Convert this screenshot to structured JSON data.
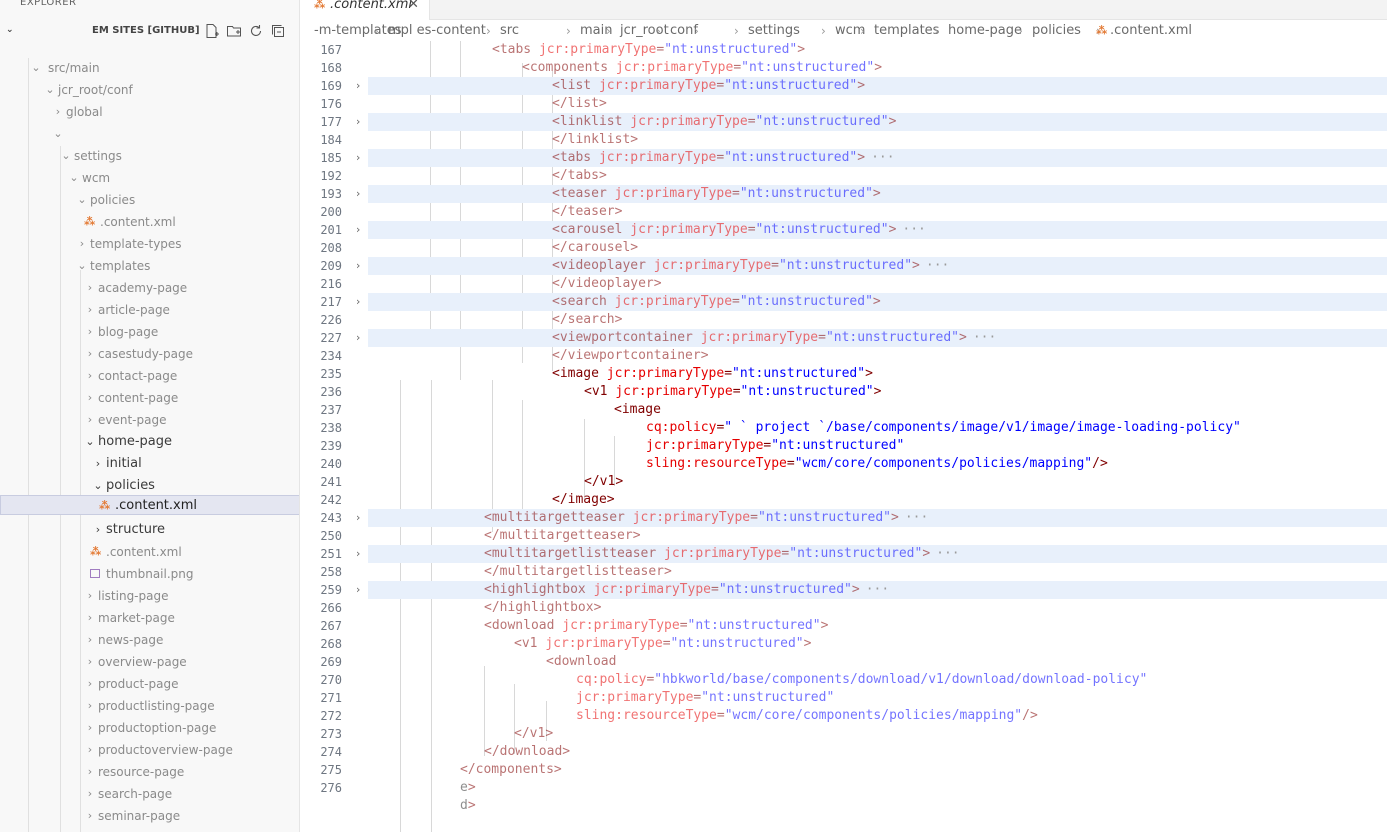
{
  "sidebar": {
    "title": "EXPLORER",
    "more_label": "···",
    "section_label": "EM SITES [GITHUB]",
    "actions": [
      "new-file-icon",
      "new-folder-icon",
      "refresh-icon",
      "collapse-icon"
    ],
    "items": [
      {
        "label": "src/main",
        "chev": "⌄"
      },
      {
        "label": "jcr_root/conf",
        "chev": "⌄"
      },
      {
        "label": "global",
        "chev": "›"
      },
      {
        "label": "",
        "chev": "⌄"
      },
      {
        "label": "settings",
        "chev": "⌄"
      },
      {
        "label": "wcm",
        "chev": "⌄"
      },
      {
        "label": "policies",
        "chev": "⌄"
      },
      {
        "label": ".content.xml",
        "chev": ""
      },
      {
        "label": "template-types",
        "chev": "›"
      },
      {
        "label": "templates",
        "chev": "⌄"
      },
      {
        "label": "academy-page",
        "chev": "›"
      },
      {
        "label": "article-page",
        "chev": "›"
      },
      {
        "label": "blog-page",
        "chev": "›"
      },
      {
        "label": "casestudy-page",
        "chev": "›"
      },
      {
        "label": "contact-page",
        "chev": "›"
      },
      {
        "label": "content-page",
        "chev": "›"
      },
      {
        "label": "event-page",
        "chev": "›"
      },
      {
        "label": "home-page",
        "chev": "⌄"
      },
      {
        "label": "initial",
        "chev": "›"
      },
      {
        "label": "policies",
        "chev": "⌄"
      },
      {
        "label": ".content.xml",
        "chev": ""
      },
      {
        "label": "structure",
        "chev": "›"
      },
      {
        "label": ".content.xml",
        "chev": ""
      },
      {
        "label": "thumbnail.png",
        "chev": ""
      },
      {
        "label": "listing-page",
        "chev": "›"
      },
      {
        "label": "market-page",
        "chev": "›"
      },
      {
        "label": "news-page",
        "chev": "›"
      },
      {
        "label": "overview-page",
        "chev": "›"
      },
      {
        "label": "product-page",
        "chev": "›"
      },
      {
        "label": "productlisting-page",
        "chev": "›"
      },
      {
        "label": "productoption-page",
        "chev": "›"
      },
      {
        "label": "productoverview-page",
        "chev": "›"
      },
      {
        "label": "resource-page",
        "chev": "›"
      },
      {
        "label": "search-page",
        "chev": "›"
      },
      {
        "label": "seminar-page",
        "chev": "›"
      }
    ]
  },
  "tab": {
    "label": ".content.xml",
    "close": "✕"
  },
  "breadcrumb": [
    "-m-templates",
    "mpl es-content",
    "src",
    "main",
    "jcr_root",
    "conf",
    "",
    "settings",
    "wcm",
    "templates",
    "home-page",
    "policies",
    ".content.xml"
  ],
  "editor": {
    "lines": [
      {
        "n": "167",
        "fold": "",
        "code": "<tabs jcr:primaryType=\"nt:unstructured\">",
        "ell": ""
      },
      {
        "n": "168",
        "fold": "",
        "code": "<components jcr:primaryType=\"nt:unstructured\">",
        "ell": ""
      },
      {
        "n": "169",
        "fold": ">",
        "code": "<list jcr:primaryType=\"nt:unstructured\">",
        "ell": ""
      },
      {
        "n": "176",
        "fold": "",
        "code": "</list>",
        "ell": ""
      },
      {
        "n": "177",
        "fold": ">",
        "code": "<linklist jcr:primaryType=\"nt:unstructured\">",
        "ell": ""
      },
      {
        "n": "184",
        "fold": "",
        "code": "</linklist>",
        "ell": ""
      },
      {
        "n": "185",
        "fold": ">",
        "code": "<tabs jcr:primaryType=\"nt:unstructured\">",
        "ell": "···"
      },
      {
        "n": "192",
        "fold": "",
        "code": "</tabs>",
        "ell": ""
      },
      {
        "n": "193",
        "fold": ">",
        "code": "<teaser jcr:primaryType=\"nt:unstructured\">",
        "ell": ""
      },
      {
        "n": "200",
        "fold": "",
        "code": "</teaser>",
        "ell": ""
      },
      {
        "n": "201",
        "fold": ">",
        "code": "<carousel jcr:primaryType=\"nt:unstructured\">",
        "ell": "···"
      },
      {
        "n": "208",
        "fold": "",
        "code": "</carousel>",
        "ell": ""
      },
      {
        "n": "209",
        "fold": ">",
        "code": "<videoplayer jcr:primaryType=\"nt:unstructured\">",
        "ell": "···"
      },
      {
        "n": "216",
        "fold": "",
        "code": "</videoplayer>",
        "ell": ""
      },
      {
        "n": "217",
        "fold": ">",
        "code": "<search jcr:primaryType=\"nt:unstructured\">",
        "ell": ""
      },
      {
        "n": "226",
        "fold": "",
        "code": "</search>",
        "ell": ""
      },
      {
        "n": "227",
        "fold": ">",
        "code": "<viewportcontainer jcr:primaryType=\"nt:unstructured\">",
        "ell": "···"
      },
      {
        "n": "234",
        "fold": "",
        "code": "</viewportcontainer>",
        "ell": ""
      },
      {
        "n": "235",
        "fold": "",
        "code": "<image jcr:primaryType=\"nt:unstructured\">",
        "ell": ""
      },
      {
        "n": "236",
        "fold": "",
        "code": "<v1 jcr:primaryType=\"nt:unstructured\">",
        "ell": ""
      },
      {
        "n": "237",
        "fold": "",
        "code": "<image",
        "ell": ""
      },
      {
        "n": "238",
        "fold": "",
        "code": "cq:policy=\" ` project `/base/components/image/v1/image/image-loading-policy\"",
        "ell": ""
      },
      {
        "n": "239",
        "fold": "",
        "code": "jcr:primaryType=\"nt:unstructured\"",
        "ell": ""
      },
      {
        "n": "240",
        "fold": "",
        "code": "sling:resourceType=\"wcm/core/components/policies/mapping\"/>",
        "ell": ""
      },
      {
        "n": "241",
        "fold": "",
        "code": "</v1>",
        "ell": ""
      },
      {
        "n": "242",
        "fold": "",
        "code": "</image>",
        "ell": ""
      },
      {
        "n": "243",
        "fold": ">",
        "code": "<multitargetteaser jcr:primaryType=\"nt:unstructured\">",
        "ell": "···"
      },
      {
        "n": "250",
        "fold": "",
        "code": "</multitargetteaser>",
        "ell": ""
      },
      {
        "n": "251",
        "fold": ">",
        "code": "<multitargetlistteaser jcr:primaryType=\"nt:unstructured\">",
        "ell": "···"
      },
      {
        "n": "258",
        "fold": "",
        "code": "</multitargetlistteaser>",
        "ell": ""
      },
      {
        "n": "259",
        "fold": ">",
        "code": "<highlightbox jcr:primaryType=\"nt:unstructured\">",
        "ell": "···"
      },
      {
        "n": "266",
        "fold": "",
        "code": "</highlightbox>",
        "ell": ""
      },
      {
        "n": "267",
        "fold": "",
        "code": "<download jcr:primaryType=\"nt:unstructured\">",
        "ell": ""
      },
      {
        "n": "268",
        "fold": "",
        "code": "<v1 jcr:primaryType=\"nt:unstructured\">",
        "ell": ""
      },
      {
        "n": "269",
        "fold": "",
        "code": "<download",
        "ell": ""
      },
      {
        "n": "270",
        "fold": "",
        "code": "cq:policy=\"hbkworld/base/components/download/v1/download/download-policy\"",
        "ell": ""
      },
      {
        "n": "271",
        "fold": "",
        "code": "jcr:primaryType=\"nt:unstructured\"",
        "ell": ""
      },
      {
        "n": "272",
        "fold": "",
        "code": "sling:resourceType=\"wcm/core/components/policies/mapping\"/>",
        "ell": ""
      },
      {
        "n": "273",
        "fold": "",
        "code": "</v1>",
        "ell": ""
      },
      {
        "n": "274",
        "fold": "",
        "code": "</download>",
        "ell": ""
      },
      {
        "n": "275",
        "fold": "",
        "code": "</components>",
        "ell": ""
      },
      {
        "n": "276",
        "fold": "",
        "code": "e>",
        "ell": ""
      },
      {
        "n": "",
        "fold": "",
        "code": "d>",
        "ell": ""
      }
    ]
  },
  "colors": {
    "tag": "#800000",
    "attribute": "#e50000",
    "string": "#0000ff",
    "fold_highlight": "#e8f0fb",
    "selection": "#e4e6f1",
    "xml_icon": "#e37933"
  }
}
